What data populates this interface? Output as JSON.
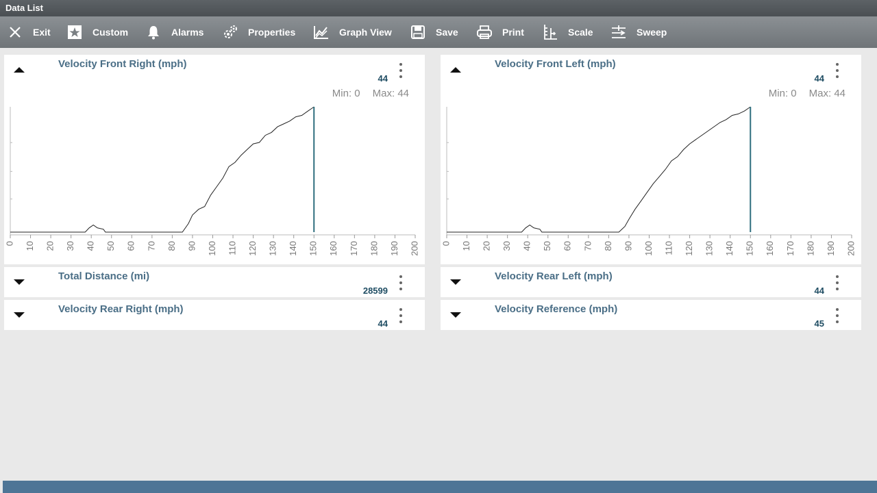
{
  "window": {
    "title": "Data List"
  },
  "toolbar": {
    "items": [
      {
        "label": "Exit",
        "icon": "close-icon"
      },
      {
        "label": "Custom",
        "icon": "star-icon"
      },
      {
        "label": "Alarms",
        "icon": "bell-icon"
      },
      {
        "label": "Properties",
        "icon": "gears-icon"
      },
      {
        "label": "Graph View",
        "icon": "graph-icon"
      },
      {
        "label": "Save",
        "icon": "floppy-icon"
      },
      {
        "label": "Print",
        "icon": "printer-icon"
      },
      {
        "label": "Scale",
        "icon": "scale-icon"
      },
      {
        "label": "Sweep",
        "icon": "sweep-icon"
      }
    ]
  },
  "panels": [
    {
      "title": "Velocity Front Right (mph)",
      "value": "44",
      "expanded": true,
      "min_label": "Min: 0",
      "max_label": "Max: 44"
    },
    {
      "title": "Velocity Front Left (mph)",
      "value": "44",
      "expanded": true,
      "min_label": "Min: 0",
      "max_label": "Max: 44"
    },
    {
      "title": "Total Distance (mi)",
      "value": "28599",
      "expanded": false
    },
    {
      "title": "Velocity Rear Left (mph)",
      "value": "44",
      "expanded": false
    },
    {
      "title": "Velocity Rear Right (mph)",
      "value": "44",
      "expanded": false
    },
    {
      "title": "Velocity Reference (mph)",
      "value": "45",
      "expanded": false
    }
  ],
  "colors": {
    "cursor": "#2f6f7f",
    "line": "#222222",
    "accent": "#4a6e86"
  },
  "chart_data": [
    {
      "type": "line",
      "title": "Velocity Front Right (mph)",
      "xlim": [
        0,
        200
      ],
      "ylim": [
        0,
        44
      ],
      "x_ticks": [
        "0",
        "10",
        "20",
        "30",
        "40",
        "50",
        "60",
        "70",
        "80",
        "90",
        "100",
        "110",
        "120",
        "130",
        "140",
        "150",
        "160",
        "170",
        "180",
        "190",
        "200"
      ],
      "cursor_x": 150,
      "series": [
        {
          "x": [
            0,
            37,
            39,
            41,
            43,
            46,
            47,
            85,
            88,
            90,
            93,
            96,
            99,
            102,
            105,
            108,
            111,
            114,
            117,
            120,
            123,
            126,
            129,
            132,
            135,
            138,
            141,
            144,
            147,
            149,
            150
          ],
          "y": [
            0,
            0,
            1.5,
            2.5,
            1.5,
            1,
            0,
            0,
            3,
            6,
            8,
            9,
            13,
            16,
            19,
            23,
            24.5,
            27,
            29,
            31,
            31.5,
            34,
            35,
            37,
            38,
            39,
            40.5,
            41,
            42.5,
            43.5,
            44
          ]
        }
      ]
    },
    {
      "type": "line",
      "title": "Velocity Front Left (mph)",
      "xlim": [
        0,
        200
      ],
      "ylim": [
        0,
        44
      ],
      "x_ticks": [
        "0",
        "10",
        "20",
        "30",
        "40",
        "50",
        "60",
        "70",
        "80",
        "90",
        "100",
        "110",
        "120",
        "130",
        "140",
        "150",
        "160",
        "170",
        "180",
        "190",
        "200"
      ],
      "cursor_x": 150,
      "series": [
        {
          "x": [
            0,
            37,
            39,
            41,
            43,
            46,
            47,
            85,
            88,
            90,
            93,
            96,
            99,
            102,
            105,
            108,
            111,
            114,
            117,
            120,
            123,
            126,
            129,
            132,
            135,
            138,
            141,
            144,
            147,
            149,
            150
          ],
          "y": [
            0,
            0,
            1.5,
            2.5,
            1.5,
            1,
            0,
            0,
            2,
            4.5,
            8,
            11,
            14,
            17,
            19.5,
            22,
            25,
            26.5,
            29,
            31,
            32.5,
            34,
            35.5,
            37,
            38.5,
            39.5,
            41,
            41.5,
            42.5,
            43.5,
            44
          ]
        }
      ]
    }
  ]
}
